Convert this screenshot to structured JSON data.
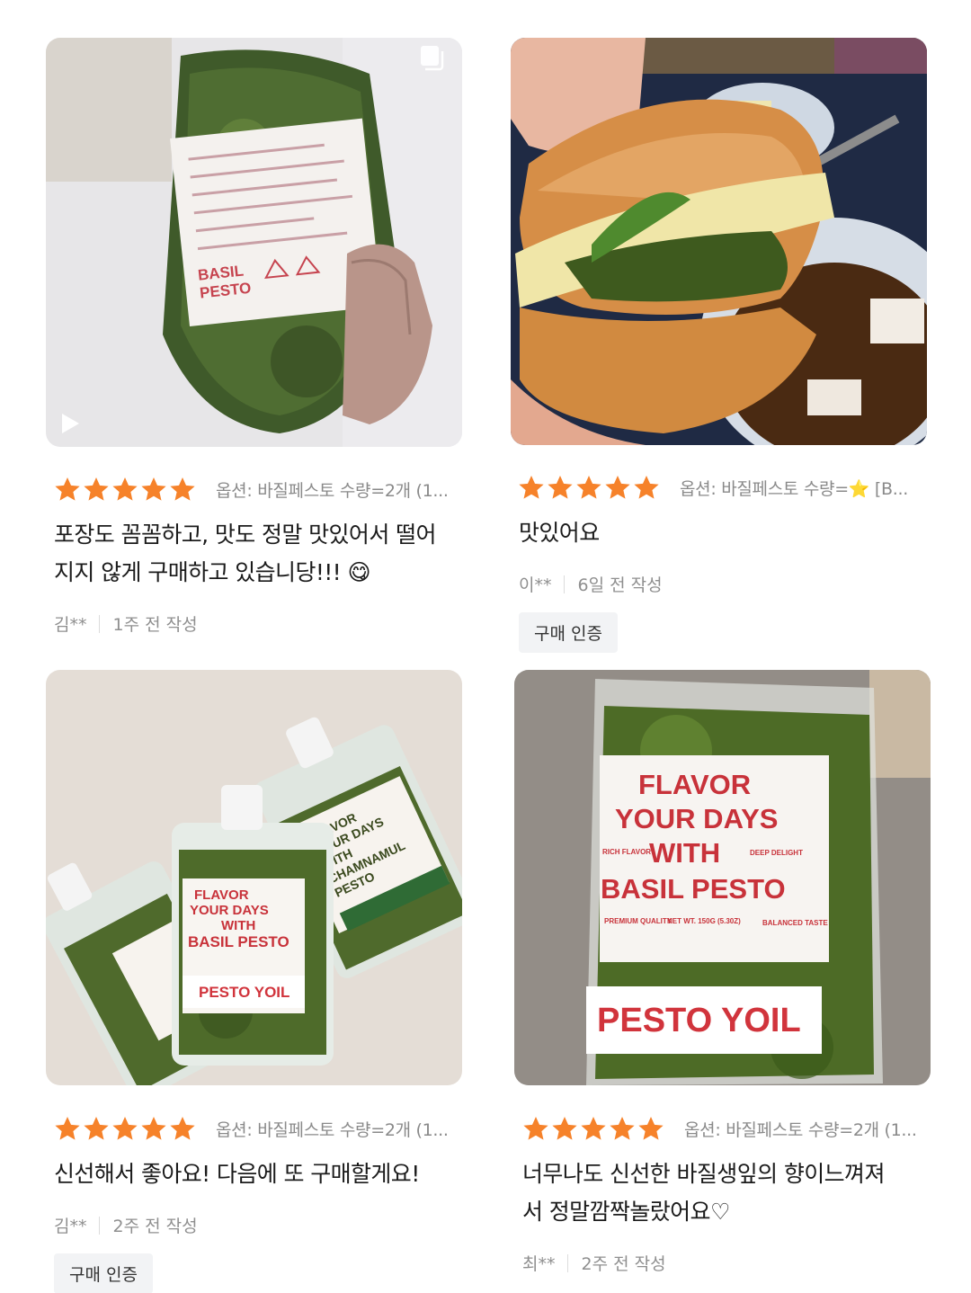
{
  "reviews": [
    {
      "option": "옵션: 바질페스토 수량=2개 (1...",
      "text_line1": "포장도 꼼꼼하고, 맛도 정말 맛있어서 떨어",
      "text_line2": "지지 않게 구매하고 있습니당!!! 😋",
      "author": "김**",
      "date": "1주 전 작성",
      "rating": 5,
      "photo": {
        "bag_label": [
          "BASIL",
          "PESTO"
        ]
      }
    },
    {
      "option": "옵션: 바질페스토 수량=⭐ [B...",
      "text_line1": "맛있어요",
      "author": "이**",
      "date": "6일 전 작성",
      "badge": "구매 인증",
      "rating": 5
    },
    {
      "option": "옵션: 바질페스토 수량=2개 (1...",
      "text_line1": "신선해서 좋아요! 다음에 또 구매할게요!",
      "author": "김**",
      "date": "2주 전 작성",
      "badge": "구매 인증",
      "rating": 5,
      "photo": {
        "pouch_a": [
          "FLAVOR",
          "YOUR DAYS",
          "WITH",
          "CHAMNAMUL",
          "PESTO"
        ],
        "pouch_b": [
          "FLAVOR",
          "YOUR DAYS",
          "WITH",
          "BASIL PESTO"
        ],
        "brand": "PESTO YOIL"
      }
    },
    {
      "option": "옵션: 바질페스토 수량=2개 (1...",
      "text_line1": "너무나도 신선한 바질생잎의 향이느껴져",
      "text_line2": "서 정말깜짝놀랐어요♡",
      "author": "최**",
      "date": "2주 전 작성",
      "rating": 5,
      "photo": {
        "label": [
          "FLAVOR",
          "YOUR DAYS",
          "WITH",
          "BASIL PESTO"
        ],
        "rich": "RICH FLAVOR",
        "deep": "DEEP DELIGHT",
        "premium": "PREMIUM QUALITY",
        "net": "NET WT. 150G (5.30Z)",
        "balanced": "BALANCED TASTE",
        "brand": "PESTO YOIL"
      }
    }
  ],
  "colors": {
    "star": "#f6822a",
    "option_text": "#8a8a8a",
    "badge_bg": "#f2f3f5"
  }
}
